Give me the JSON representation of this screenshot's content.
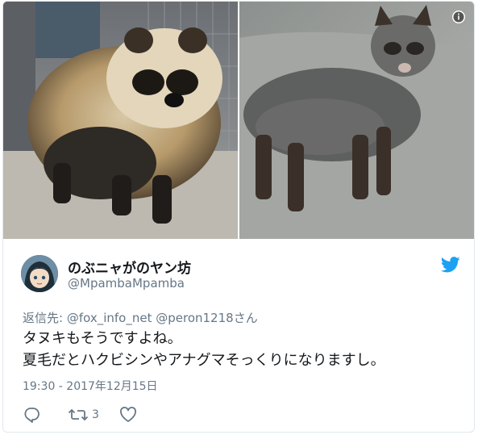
{
  "media": {
    "info_icon": "info-icon",
    "left_photo": "raccoon-dog-winter-coat",
    "right_photo": "raccoon-dog-summer-coat"
  },
  "author": {
    "display_name": "のぶニャがのヤン坊",
    "handle": "@MpambaMpamba"
  },
  "reply_to": {
    "prefix": "返信先: ",
    "mention1": "@fox_info_net",
    "mention2": "@peron1218",
    "suffix": "さん"
  },
  "tweet": {
    "line1": "タヌキもそうですよね。",
    "line2": "夏毛だとハクビシンやアナグマそっくりになりますし。",
    "timestamp": "19:30 - 2017年12月15日"
  },
  "actions": {
    "reply_icon": "reply-icon",
    "retweet_icon": "retweet-icon",
    "retweet_count": "3",
    "like_icon": "heart-icon"
  },
  "colors": {
    "twitter_blue": "#1da1f2",
    "secondary_text": "#657786",
    "primary_text": "#14171a"
  }
}
